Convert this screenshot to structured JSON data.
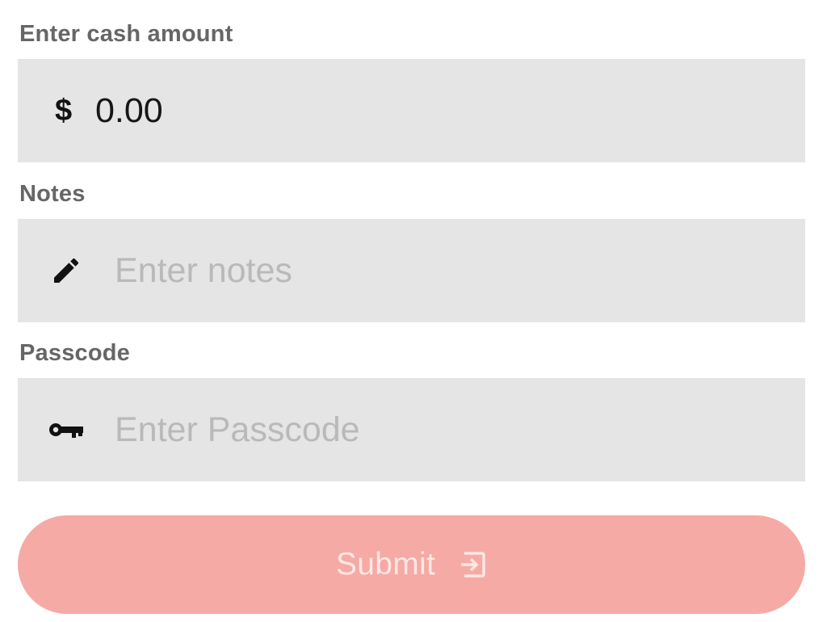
{
  "cash": {
    "label": "Enter cash amount",
    "currency_symbol": "$",
    "value": "0.00"
  },
  "notes": {
    "label": "Notes",
    "placeholder": "Enter notes",
    "icon": "pencil-icon"
  },
  "passcode": {
    "label": "Passcode",
    "placeholder": "Enter Passcode",
    "icon": "key-icon"
  },
  "submit": {
    "label": "Submit",
    "icon": "sign-in-icon"
  },
  "colors": {
    "field_bg": "#e5e5e5",
    "label": "#666666",
    "placeholder": "#b9b9b9",
    "submit_bg": "#f5aaa5",
    "submit_text": "#fde7e4"
  }
}
